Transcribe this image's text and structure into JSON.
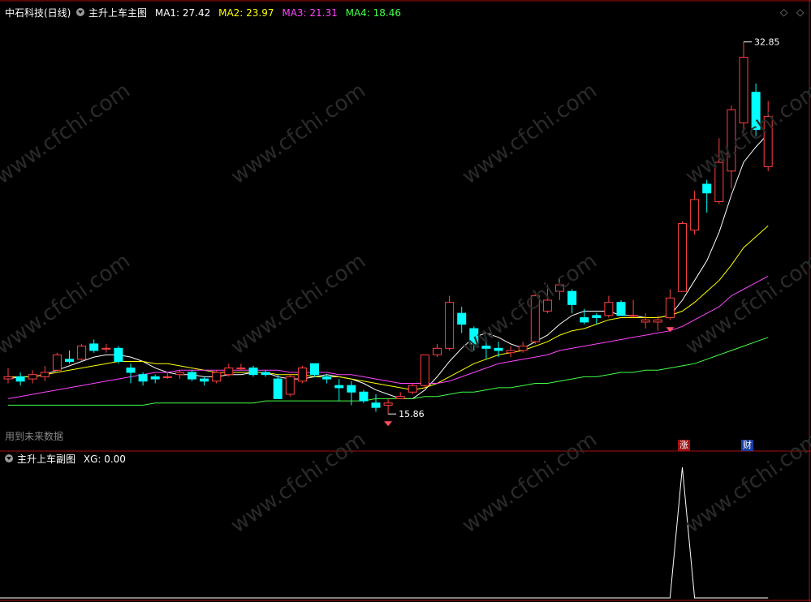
{
  "main_panel": {
    "stock_title": "中石科技(日线)",
    "indicator_name": "主升上车主图",
    "ma_labels": [
      {
        "text": "MA1: 27.42",
        "color": "#ffffff"
      },
      {
        "text": "MA2: 23.97",
        "color": "#ffff00"
      },
      {
        "text": "MA3: 21.31",
        "color": "#ff44ff"
      },
      {
        "text": "MA4: 18.46",
        "color": "#44ff44"
      }
    ],
    "high_label": "32.85",
    "low_label": "15.86",
    "future_data_label": "用到未来数据",
    "zhang_tag": "涨",
    "cai_tag": "财"
  },
  "sub_panel": {
    "indicator_name": "主升上车副图",
    "xg_label": "XG: 0.00"
  },
  "watermark": "www.cfchi.com",
  "colors": {
    "background": "#000000",
    "up_candle": "#ff4040",
    "down_candle": "#00ffff",
    "ma1": "#ffffff",
    "ma2": "#ffff00",
    "ma3": "#ff44ff",
    "ma4": "#44ff44",
    "grid_border": "#aa1111",
    "signal_line": "#ffffff"
  },
  "chart_data": [
    {
      "type": "candlestick",
      "title": "中石科技(日线)",
      "ylim": [
        14.5,
        34
      ],
      "candles": [
        [
          17.5,
          17.6,
          18.0,
          17.3
        ],
        [
          17.6,
          17.4,
          17.8,
          17.2
        ],
        [
          17.5,
          17.7,
          17.9,
          17.3
        ],
        [
          17.6,
          17.8,
          18.1,
          17.4
        ],
        [
          17.9,
          18.6,
          18.7,
          17.8
        ],
        [
          18.4,
          18.3,
          18.8,
          18.2
        ],
        [
          18.4,
          19.0,
          19.1,
          18.3
        ],
        [
          19.1,
          18.8,
          19.3,
          18.7
        ],
        [
          18.9,
          18.9,
          19.1,
          18.7
        ],
        [
          18.9,
          18.3,
          19.0,
          18.2
        ],
        [
          18.0,
          17.8,
          18.2,
          17.3
        ],
        [
          17.7,
          17.4,
          17.8,
          17.2
        ],
        [
          17.6,
          17.5,
          17.7,
          17.3
        ],
        [
          17.6,
          17.6,
          17.8,
          17.5
        ],
        [
          17.7,
          17.8,
          17.9,
          17.5
        ],
        [
          17.8,
          17.5,
          17.9,
          17.4
        ],
        [
          17.5,
          17.4,
          17.6,
          17.2
        ],
        [
          17.4,
          17.8,
          17.9,
          17.3
        ],
        [
          17.7,
          18.0,
          18.2,
          17.6
        ],
        [
          18.0,
          18.0,
          18.2,
          17.9
        ],
        [
          18.0,
          17.7,
          18.1,
          17.6
        ],
        [
          17.8,
          17.7,
          17.9,
          17.6
        ],
        [
          17.5,
          16.6,
          17.7,
          16.6
        ],
        [
          16.8,
          17.6,
          17.7,
          16.7
        ],
        [
          17.4,
          18.0,
          18.1,
          17.3
        ],
        [
          18.2,
          17.7,
          18.2,
          17.6
        ],
        [
          17.6,
          17.5,
          17.7,
          17.3
        ],
        [
          17.2,
          17.1,
          17.5,
          16.5
        ],
        [
          17.2,
          16.9,
          17.4,
          16.3
        ],
        [
          16.9,
          16.5,
          17.0,
          16.4
        ],
        [
          16.4,
          16.2,
          16.8,
          16.0
        ],
        [
          16.3,
          16.4,
          16.6,
          15.9
        ],
        [
          16.6,
          16.7,
          16.9,
          16.6
        ],
        [
          16.9,
          17.2,
          17.3,
          16.8
        ],
        [
          17.2,
          18.6,
          18.6,
          17.1
        ],
        [
          18.6,
          18.9,
          19.1,
          18.5
        ],
        [
          18.9,
          21.0,
          21.3,
          18.8
        ],
        [
          20.5,
          20.0,
          20.8,
          19.6
        ],
        [
          19.8,
          19.1,
          19.9,
          18.8
        ],
        [
          19.0,
          18.9,
          19.4,
          18.4
        ],
        [
          18.9,
          18.8,
          19.2,
          18.5
        ],
        [
          18.7,
          18.8,
          19.0,
          18.5
        ],
        [
          18.8,
          19.0,
          19.2,
          18.7
        ],
        [
          19.2,
          21.3,
          21.5,
          19.1
        ],
        [
          20.6,
          21.1,
          21.8,
          20.5
        ],
        [
          21.5,
          21.8,
          22.1,
          21.1
        ],
        [
          21.5,
          20.9,
          21.6,
          20.5
        ],
        [
          20.3,
          20.1,
          20.7,
          20.0
        ],
        [
          20.4,
          20.3,
          20.5,
          20.0
        ],
        [
          20.4,
          21.0,
          21.3,
          20.3
        ],
        [
          21.0,
          20.4,
          21.1,
          20.4
        ],
        [
          20.4,
          20.4,
          21.1,
          20.3
        ],
        [
          20.1,
          20.2,
          20.5,
          19.8
        ],
        [
          20.1,
          20.2,
          20.4,
          19.7
        ],
        [
          20.3,
          21.2,
          21.6,
          20.2
        ],
        [
          21.5,
          24.6,
          24.7,
          21.5
        ],
        [
          24.3,
          25.7,
          26.1,
          24.1
        ],
        [
          26.4,
          26.0,
          26.6,
          25.1
        ],
        [
          25.6,
          27.4,
          28.5,
          25.5
        ],
        [
          27.0,
          29.8,
          30.0,
          26.2
        ],
        [
          29.2,
          32.2,
          32.9,
          28.8
        ],
        [
          30.6,
          28.9,
          31.0,
          28.6
        ],
        [
          27.2,
          29.5,
          30.2,
          27.0
        ]
      ],
      "series": [
        {
          "name": "MA1",
          "values": [
            17.5,
            17.6,
            17.6,
            17.7,
            17.9,
            18.1,
            18.3,
            18.5,
            18.6,
            18.6,
            18.5,
            18.3,
            18.0,
            17.8,
            17.7,
            17.7,
            17.6,
            17.6,
            17.7,
            17.7,
            17.8,
            17.8,
            17.6,
            17.5,
            17.5,
            17.6,
            17.7,
            17.6,
            17.5,
            17.3,
            17.0,
            16.8,
            16.6,
            16.6,
            17.0,
            17.6,
            18.3,
            18.9,
            19.4,
            19.6,
            19.4,
            19.1,
            18.9,
            19.2,
            19.5,
            20.0,
            20.4,
            20.6,
            20.6,
            20.6,
            20.4,
            20.4,
            20.3,
            20.3,
            20.4,
            21.1,
            22.0,
            22.9,
            24.2,
            25.9,
            27.4,
            28.1,
            28.7
          ]
        },
        {
          "name": "MA2",
          "values": [
            17.6,
            17.6,
            17.6,
            17.7,
            17.8,
            17.9,
            18.0,
            18.1,
            18.2,
            18.3,
            18.3,
            18.3,
            18.2,
            18.2,
            18.1,
            18.0,
            17.9,
            17.8,
            17.8,
            17.8,
            17.8,
            17.8,
            17.7,
            17.7,
            17.7,
            17.6,
            17.6,
            17.6,
            17.5,
            17.4,
            17.3,
            17.2,
            17.1,
            17.0,
            17.1,
            17.3,
            17.6,
            17.9,
            18.2,
            18.4,
            18.6,
            18.7,
            18.8,
            19.0,
            19.2,
            19.5,
            19.7,
            19.8,
            20.0,
            20.2,
            20.3,
            20.3,
            20.3,
            20.3,
            20.4,
            20.6,
            21.0,
            21.5,
            22.0,
            22.7,
            23.5,
            24.0,
            24.5
          ]
        },
        {
          "name": "MA3",
          "values": [
            16.6,
            16.7,
            16.8,
            16.9,
            17.0,
            17.1,
            17.2,
            17.3,
            17.4,
            17.5,
            17.6,
            17.7,
            17.8,
            17.8,
            17.9,
            17.9,
            17.9,
            17.9,
            17.9,
            17.9,
            17.9,
            17.9,
            17.9,
            17.8,
            17.8,
            17.8,
            17.8,
            17.7,
            17.7,
            17.6,
            17.5,
            17.4,
            17.3,
            17.3,
            17.3,
            17.3,
            17.4,
            17.6,
            17.8,
            18.0,
            18.2,
            18.3,
            18.4,
            18.5,
            18.6,
            18.8,
            18.9,
            19.0,
            19.1,
            19.2,
            19.3,
            19.4,
            19.5,
            19.6,
            19.7,
            19.9,
            20.2,
            20.5,
            20.8,
            21.3,
            21.6,
            21.9,
            22.2
          ]
        },
        {
          "name": "MA4",
          "values": [
            16.3,
            16.3,
            16.3,
            16.3,
            16.3,
            16.3,
            16.3,
            16.3,
            16.3,
            16.3,
            16.3,
            16.3,
            16.4,
            16.4,
            16.4,
            16.4,
            16.4,
            16.4,
            16.4,
            16.4,
            16.4,
            16.5,
            16.5,
            16.5,
            16.5,
            16.5,
            16.5,
            16.5,
            16.5,
            16.5,
            16.6,
            16.6,
            16.6,
            16.6,
            16.7,
            16.7,
            16.8,
            16.9,
            16.9,
            17.0,
            17.1,
            17.1,
            17.2,
            17.3,
            17.3,
            17.4,
            17.5,
            17.6,
            17.6,
            17.7,
            17.8,
            17.8,
            17.9,
            17.9,
            18.0,
            18.1,
            18.2,
            18.4,
            18.6,
            18.8,
            19.0,
            19.2,
            19.4
          ]
        }
      ]
    },
    {
      "type": "line",
      "title": "主升上车副图",
      "series": [
        {
          "name": "XG",
          "values": [
            0,
            0,
            0,
            0,
            0,
            0,
            0,
            0,
            0,
            0,
            0,
            0,
            0,
            0,
            0,
            0,
            0,
            0,
            0,
            0,
            0,
            0,
            0,
            0,
            0,
            0,
            0,
            0,
            0,
            0,
            0,
            0,
            0,
            0,
            0,
            0,
            0,
            0,
            0,
            0,
            0,
            0,
            0,
            0,
            0,
            0,
            0,
            0,
            0,
            0,
            0,
            0,
            0,
            0,
            0,
            1,
            0,
            0,
            0,
            0,
            0,
            0,
            0
          ]
        }
      ],
      "ylim": [
        0,
        1
      ]
    }
  ]
}
